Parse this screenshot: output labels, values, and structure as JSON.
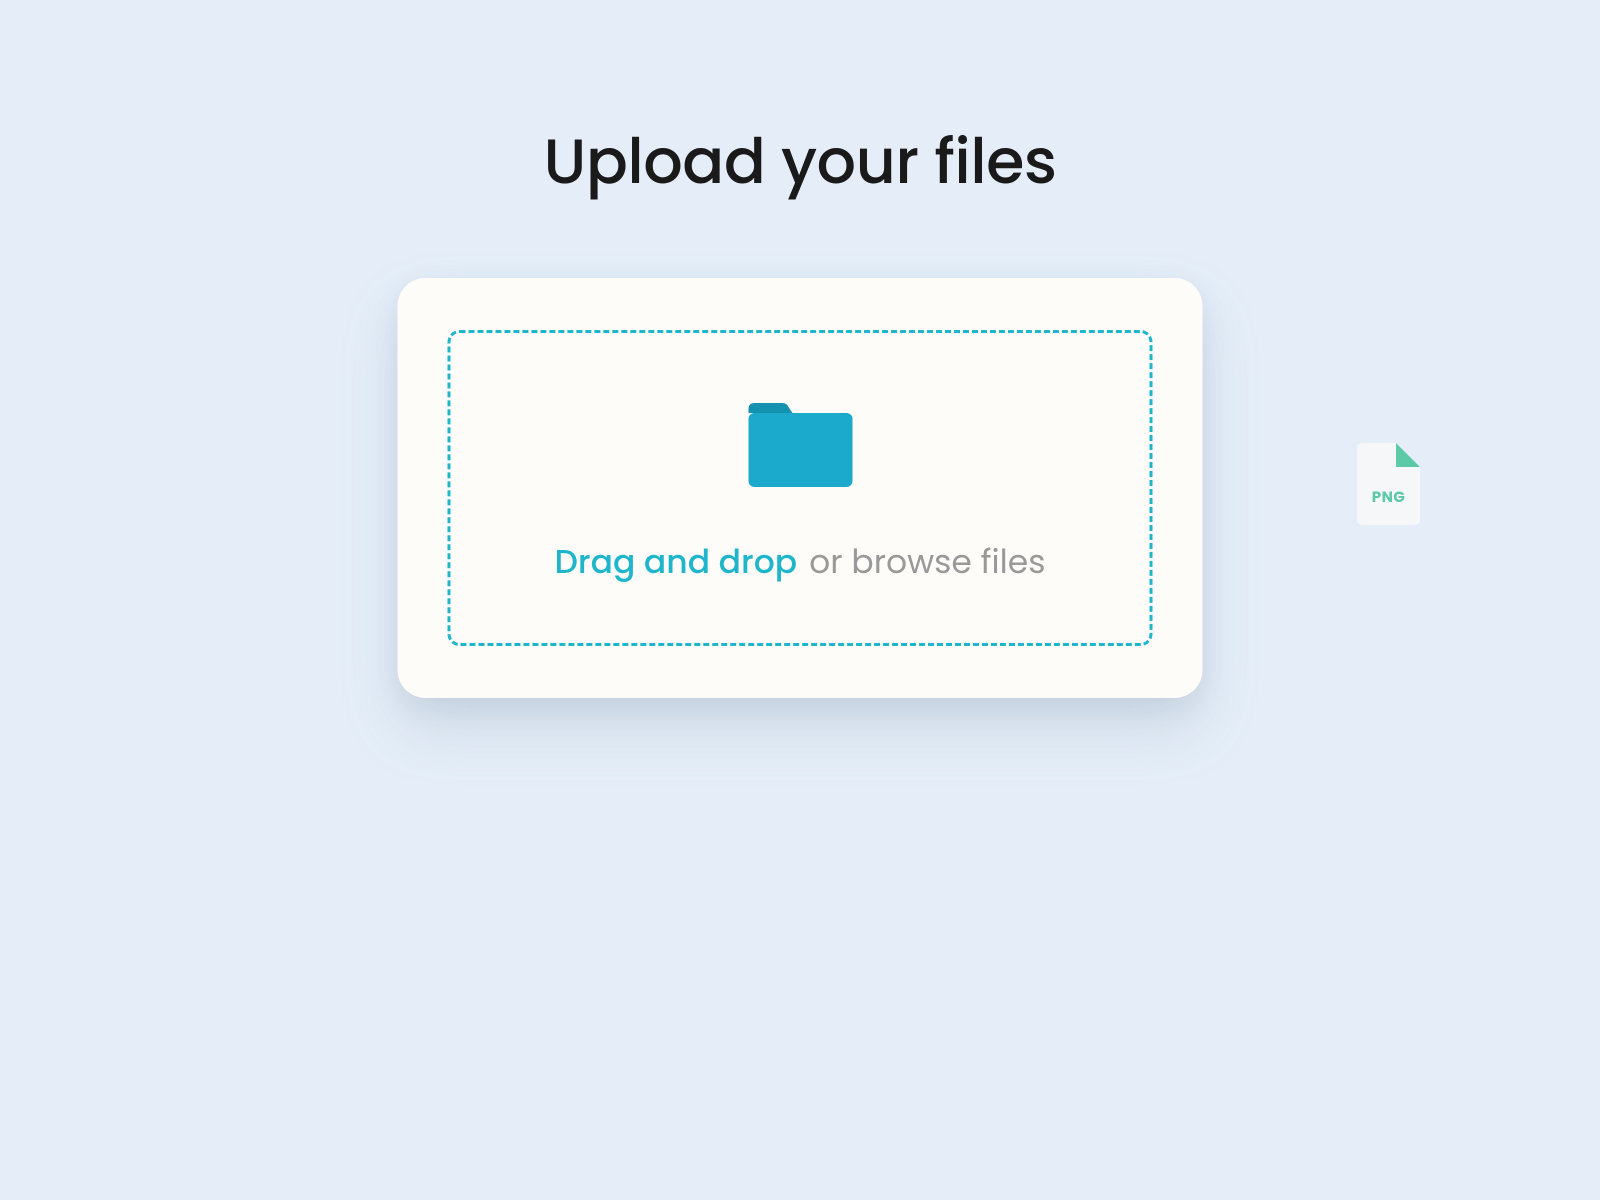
{
  "header": {
    "title": "Upload your files"
  },
  "dropzone": {
    "primary_text": "Drag and drop",
    "secondary_text": "or browse files"
  },
  "file": {
    "type_label": "PNG"
  },
  "colors": {
    "background": "#e5eef8",
    "card_bg": "#fdfcf8",
    "accent": "#1fb6cc",
    "folder_primary": "#1ba9cc",
    "folder_tab": "#1591b0",
    "text_muted": "#999999",
    "file_accent": "#5cc9a7"
  }
}
